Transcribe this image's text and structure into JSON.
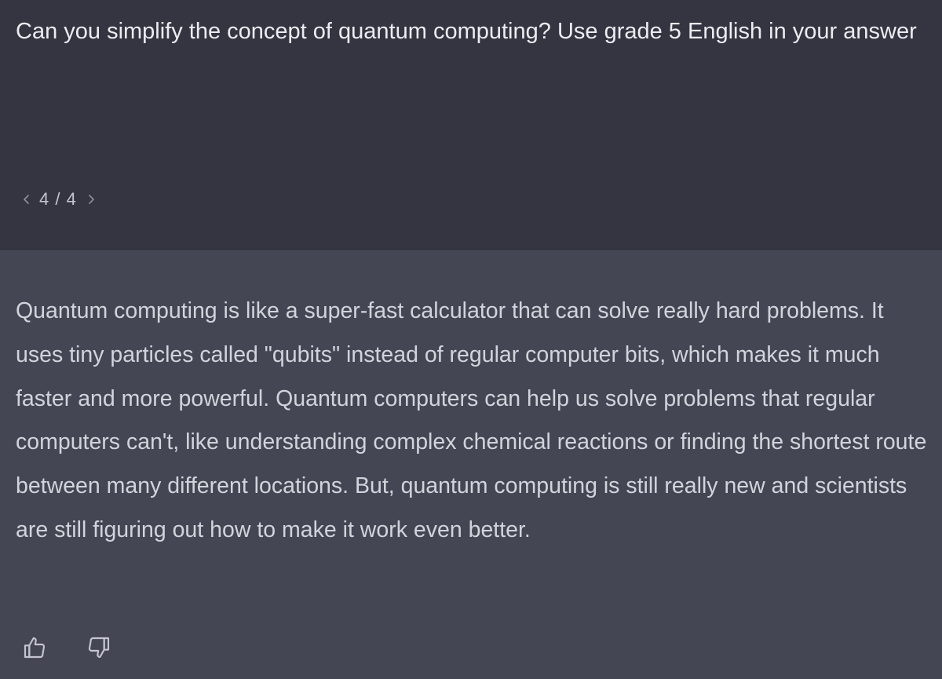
{
  "user_message": {
    "text": "Can you simplify the concept of quantum computing? Use grade 5 English in your answer"
  },
  "pager": {
    "current": "4",
    "total": "4",
    "label": "4 / 4",
    "prev_icon": "chevron-left-icon",
    "next_icon": "chevron-right-icon"
  },
  "assistant_message": {
    "text": "Quantum computing is like a super-fast calculator that can solve really hard problems. It uses tiny particles called \"qubits\" instead of regular computer bits, which makes it much faster and more powerful. Quantum computers can help us solve problems that regular computers can't, like understanding complex chemical reactions or finding the shortest route between many different locations. But, quantum computing is still really new and scientists are still figuring out how to make it work even better."
  },
  "feedback": {
    "like_icon": "thumbs-up-icon",
    "dislike_icon": "thumbs-down-icon"
  },
  "colors": {
    "user_bg": "#343541",
    "assistant_bg": "#444654",
    "user_text": "#ececf1",
    "assistant_text": "#d1d5db",
    "muted": "#c5c5d2"
  }
}
